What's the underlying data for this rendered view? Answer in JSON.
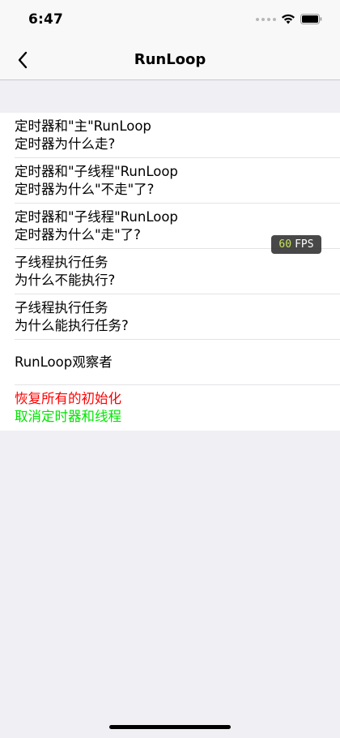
{
  "status_bar": {
    "time": "6:47"
  },
  "nav": {
    "title": "RunLoop",
    "back_icon": "chevron-left-icon"
  },
  "rows": [
    {
      "line1": "定时器和\"主\"RunLoop",
      "line2": "定时器为什么走?"
    },
    {
      "line1": "定时器和\"子线程\"RunLoop",
      "line2": "定时器为什么\"不走\"了?"
    },
    {
      "line1": "定时器和\"子线程\"RunLoop",
      "line2": "定时器为什么\"走\"了?"
    },
    {
      "line1": "子线程执行任务",
      "line2": "为什么不能执行?"
    },
    {
      "line1": "子线程执行任务",
      "line2": "为什么能执行任务?"
    },
    {
      "line1": "RunLoop观察者"
    },
    {
      "line1": "恢复所有的初始化",
      "line2": "取消定时器和线程",
      "line1_color": "#ff0000",
      "line2_color": "#00e600"
    }
  ],
  "fps": {
    "value": "60",
    "label": "FPS"
  }
}
